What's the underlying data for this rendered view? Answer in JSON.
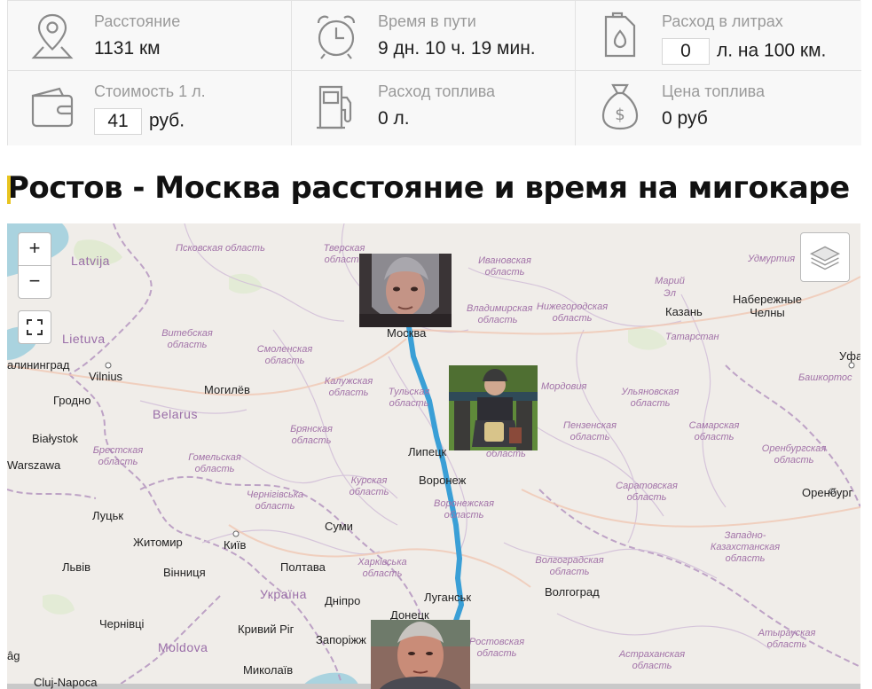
{
  "stats": {
    "distance": {
      "label": "Расстояние",
      "value": "1131 км"
    },
    "time": {
      "label": "Время в пути",
      "value": "9 дн. 10 ч. 19 мин."
    },
    "consumption": {
      "label": "Расход в литрах",
      "input": "0",
      "suffix": "л. на 100 км."
    },
    "price_per_l": {
      "label": "Стоимость 1 л.",
      "input": "41",
      "suffix": "руб."
    },
    "fuel_total": {
      "label": "Расход топлива",
      "value": "0 л."
    },
    "fuel_price": {
      "label": "Цена топлива",
      "value": "0 руб"
    }
  },
  "title": "Ростов - Москва расстояние и время на мигокаре",
  "map": {
    "zoom_in": "+",
    "zoom_out": "−",
    "route_color": "#3a9fd6",
    "countries": {
      "latvia": "Latvija",
      "lietuva": "Lietuva",
      "belarus": "Belarus",
      "ukraina": "Україна",
      "moldova": "Moldova"
    },
    "cities": {
      "moskva": "Москва",
      "lipetsk": "Липецк",
      "voronezh": "Воронеж",
      "lugansk": "Луганськ",
      "donetsk": "Донецк",
      "kazan": "Казань",
      "naberezhnye": "Набережные Челны",
      "ufa": "Уфа",
      "volgograd": "Волгоград",
      "orenburg": "Оренбург",
      "vilnius": "Vilnius",
      "kaliningrad": "алининград",
      "grodno": "Гродно",
      "bialystok": "Białystok",
      "warszawa": "Warszawa",
      "mogilev": "Могилёв",
      "lutsk": "Луцьк",
      "zhytomyr": "Житомир",
      "kyiv": "Київ",
      "sumy": "Суми",
      "poltava": "Полтава",
      "lviv": "Львів",
      "vinnytsia": "Вінниця",
      "chernivtsi": "Чернівці",
      "kryvyi": "Кривий Ріг",
      "dnipro": "Дніпро",
      "zaporizhzhia": "Запоріжж",
      "mykolaiv": "Миколаїв",
      "cluj": "Cluj-Napoca",
      "iag": "âg",
      "mariy": "Марий Эл"
    },
    "regions": {
      "pskov": "Псковская область",
      "tver": "Тверская область",
      "ivanovo": "Ивановская область",
      "udmurtia": "Удмуртия",
      "vladimir": "Владимирская область",
      "nizhny": "Нижегородская область",
      "tatarstan": "Татарстан",
      "vitebsk": "Витебская область",
      "smolensk": "Смоленская область",
      "kaluga": "Калужская область",
      "tula": "Тульская область",
      "mordovia": "Мордовия",
      "ulyanovsk": "Ульяновская область",
      "bashkortostan": "Башкортос",
      "bryansk": "Брянская область",
      "penza": "Пензенская область",
      "samara": "Самарская область",
      "orenburg_obl": "Оренбургская область",
      "brest": "Брестская область",
      "gomel": "Гомельская область",
      "chernihiv": "Чернігівська область",
      "kursk": "Курская область",
      "voronezh_obl": "Воронежская область",
      "saratov": "Саратовская область",
      "kharkiv": "Харківська область",
      "west_kz": "Западно-Казахстанская область",
      "volgograd_obl": "Волгоградская область",
      "rostov": "Ростовская область",
      "astrakhan": "Астраханская область",
      "atyrau": "Атырауская область",
      "lipetsk_obl": "область"
    }
  }
}
